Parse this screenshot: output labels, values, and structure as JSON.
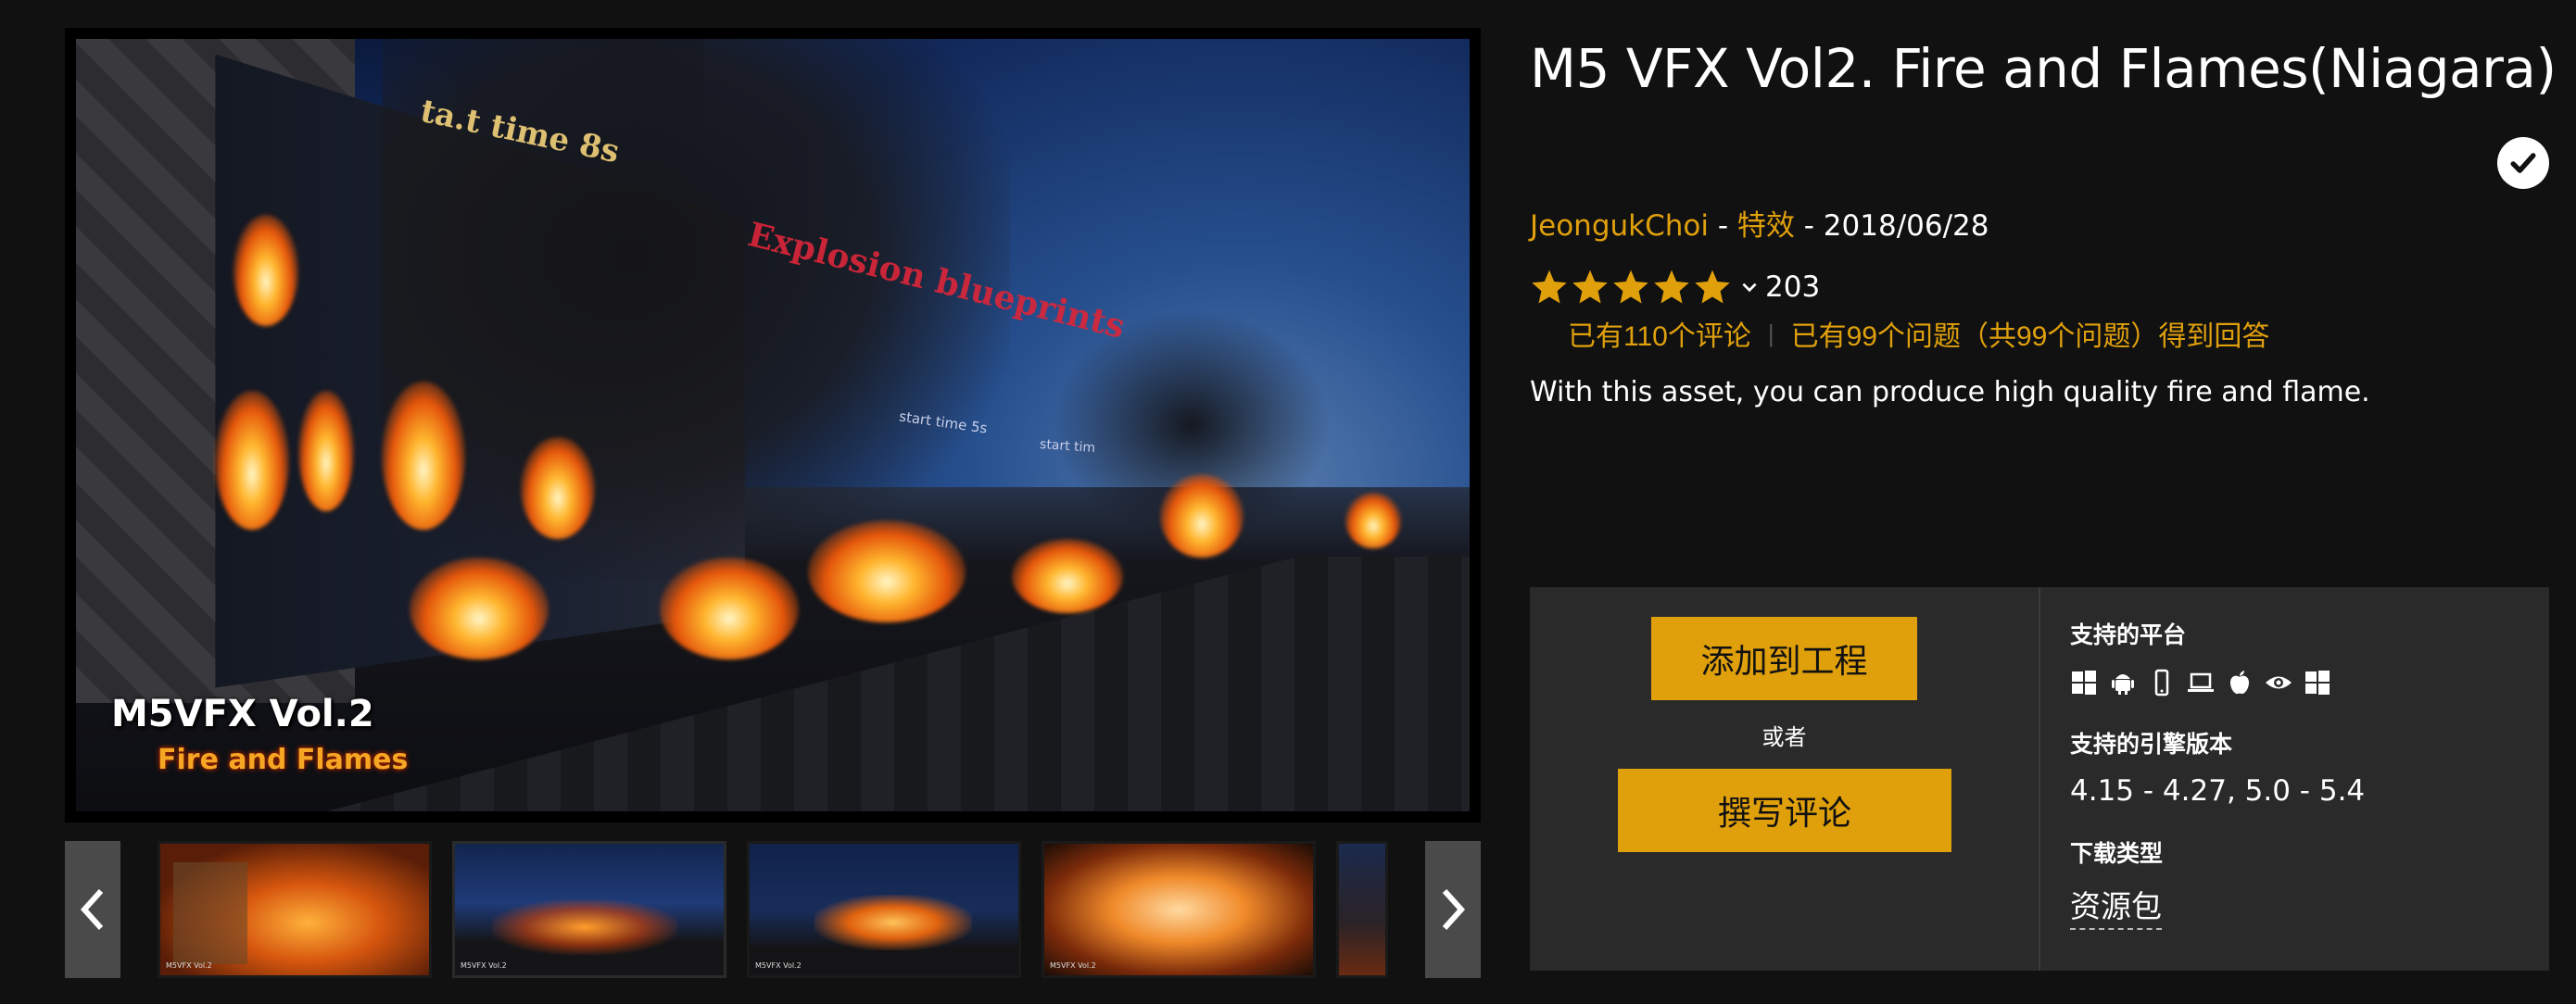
{
  "product": {
    "title": "M5 VFX Vol2. Fire and Flames(Niagara)",
    "author": "JeongukChoi",
    "category": "特效",
    "separator": "-",
    "date": "2018/06/28",
    "rating_stars": 5,
    "rating_count": "203",
    "reviews_link": "已有110个评论",
    "questions_link": "已有99个问题（共99个问题）得到回答",
    "description": "With this asset, you can produce high quality fire and flame.",
    "owned_icon": "check-circle-icon"
  },
  "hero": {
    "caption_main": "M5VFX Vol.2",
    "caption_sub": "Fire and Flames",
    "sign_a": "ta.t time 8s",
    "sign_b": "Explosion blueprints",
    "sign_c": "start time 5s",
    "sign_d": "start tim"
  },
  "thumbnails": {
    "prev_icon": "chevron-left-icon",
    "next_icon": "chevron-right-icon",
    "items": [
      {
        "label": "M5VFX Vol.2",
        "active": false
      },
      {
        "label": "M5VFX Vol.2",
        "active": true
      },
      {
        "label": "M5VFX Vol.2",
        "active": false
      },
      {
        "label": "M5VFX Vol.2",
        "active": false
      },
      {
        "label": "",
        "active": false
      }
    ]
  },
  "actions": {
    "add_to_project": "添加到工程",
    "or": "或者",
    "write_review": "撰写评论"
  },
  "details": {
    "platforms_label": "支持的平台",
    "platforms": [
      "windows-icon",
      "android-icon",
      "mobile-icon",
      "laptop-icon",
      "apple-icon",
      "eye-icon",
      "windows-icon"
    ],
    "engine_label": "支持的引擎版本",
    "engine_versions": "4.15 - 4.27, 5.0 - 5.4",
    "download_label": "下载类型",
    "download_type": "资源包"
  },
  "colors": {
    "background": "#111111",
    "accent": "#e0a00c",
    "panel": "#2a2a2a"
  }
}
